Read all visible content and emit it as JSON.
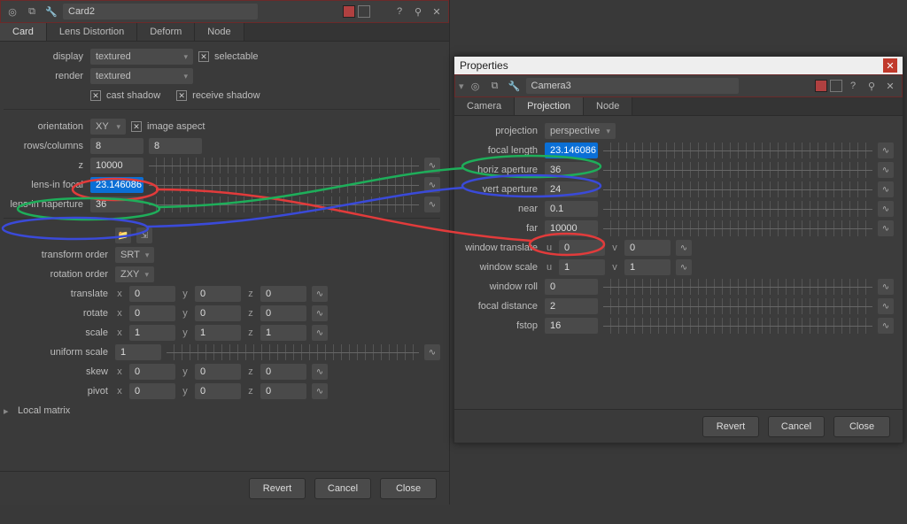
{
  "card": {
    "title": "Card2",
    "tabs": [
      "Card",
      "Lens Distortion",
      "Deform",
      "Node"
    ],
    "active_tab": "Card",
    "display_label": "display",
    "display_value": "textured",
    "selectable_label": "selectable",
    "render_label": "render",
    "render_value": "textured",
    "cast_shadow": "cast shadow",
    "receive_shadow": "receive shadow",
    "orientation_label": "orientation",
    "orientation_value": "XY",
    "image_aspect": "image aspect",
    "rows_cols_label": "rows/columns",
    "rows_value": "8",
    "cols_value": "8",
    "z_label": "z",
    "z_value": "10000",
    "lens_in_focal_label": "lens-in focal",
    "lens_in_focal_value": "23.146086",
    "lens_in_haperture_label": "lens-in haperture",
    "lens_in_haperture_value": "36",
    "transform_order_label": "transform order",
    "transform_order_value": "SRT",
    "rotation_order_label": "rotation order",
    "rotation_order_value": "ZXY",
    "translate_label": "translate",
    "rotate_label": "rotate",
    "scale_label": "scale",
    "uniform_scale_label": "uniform scale",
    "skew_label": "skew",
    "pivot_label": "pivot",
    "local_matrix": "Local matrix",
    "translate": {
      "x": "0",
      "y": "0",
      "z": "0"
    },
    "rotate": {
      "x": "0",
      "y": "0",
      "z": "0"
    },
    "scale": {
      "x": "1",
      "y": "1",
      "z": "1"
    },
    "uniform_scale": "1",
    "skew": {
      "x": "0",
      "y": "0",
      "z": "0"
    },
    "pivot": {
      "x": "0",
      "y": "0",
      "z": "0"
    },
    "x": "x",
    "y": "y",
    "zl": "z",
    "u": "u",
    "v": "v"
  },
  "props": {
    "win_title": "Properties",
    "title": "Camera3",
    "tabs": [
      "Camera",
      "Projection",
      "Node"
    ],
    "active_tab": "Projection",
    "projection_label": "projection",
    "projection_value": "perspective",
    "focal_length_label": "focal length",
    "focal_length_value": "23.146086",
    "horiz_ap_label": "horiz aperture",
    "horiz_ap_value": "36",
    "vert_ap_label": "vert aperture",
    "vert_ap_value": "24",
    "near_label": "near",
    "near_value": "0.1",
    "far_label": "far",
    "far_value": "10000",
    "win_translate_label": "window translate",
    "win_translate_u": "0",
    "win_translate_v": "0",
    "win_scale_label": "window scale",
    "win_scale_u": "1",
    "win_scale_v": "1",
    "win_roll_label": "window roll",
    "win_roll_value": "0",
    "focal_dist_label": "focal distance",
    "focal_dist_value": "2",
    "fstop_label": "fstop",
    "fstop_value": "16"
  },
  "buttons": {
    "revert": "Revert",
    "cancel": "Cancel",
    "close": "Close"
  },
  "icons": {
    "triangle": "▾",
    "gear": "⚙",
    "target": "◎",
    "wrench": "🔧",
    "help": "?",
    "pin": "⚲",
    "max": "□",
    "x": "✕"
  }
}
